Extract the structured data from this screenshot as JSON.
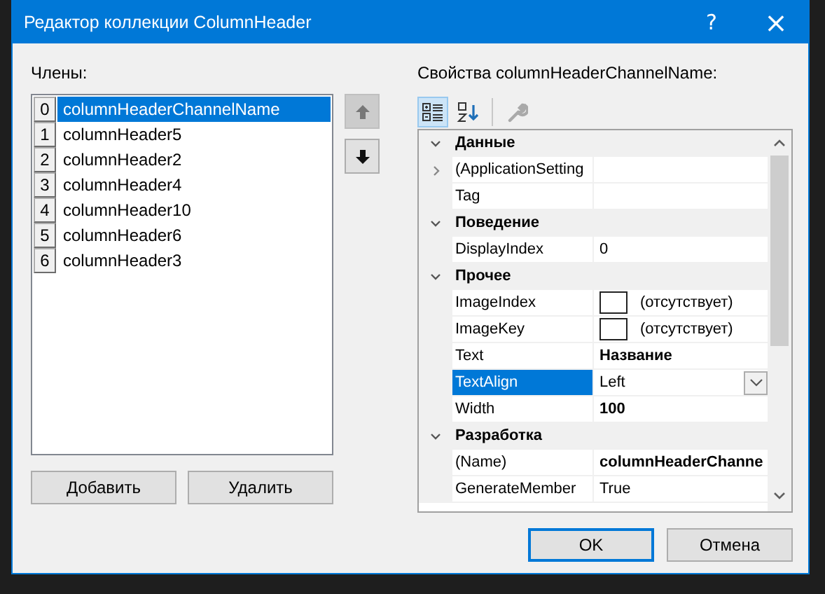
{
  "window": {
    "title": "Редактор коллекции ColumnHeader",
    "help": "?",
    "close": "×"
  },
  "members": {
    "label": "Члены:",
    "items": [
      {
        "index": "0",
        "name": "columnHeaderChannelName",
        "selected": true
      },
      {
        "index": "1",
        "name": "columnHeader5",
        "selected": false
      },
      {
        "index": "2",
        "name": "columnHeader2",
        "selected": false
      },
      {
        "index": "3",
        "name": "columnHeader4",
        "selected": false
      },
      {
        "index": "4",
        "name": "columnHeader10",
        "selected": false
      },
      {
        "index": "5",
        "name": "columnHeader6",
        "selected": false
      },
      {
        "index": "6",
        "name": "columnHeader3",
        "selected": false
      }
    ],
    "move_buttons": [
      {
        "kind": "up",
        "disabled": true
      },
      {
        "kind": "down",
        "disabled": false
      }
    ],
    "buttons": [
      "Добавить",
      "Удалить"
    ]
  },
  "properties": {
    "label": "Свойства columnHeaderChannelName:",
    "toolbar": [
      {
        "kind": "categorized",
        "selected": true,
        "disabled": false
      },
      {
        "kind": "alphabetical",
        "selected": false,
        "disabled": false
      },
      {
        "kind": "property-pages",
        "selected": false,
        "disabled": true
      }
    ],
    "categories": [
      {
        "name": "Данные",
        "expanded": true,
        "children": [
          {
            "name": "(ApplicationSetting",
            "kind": "text",
            "expandable": true,
            "selected": false
          },
          {
            "name": "Tag",
            "kind": "text",
            "expandable": false,
            "selected": false
          }
        ]
      },
      {
        "name": "Поведение",
        "expanded": true,
        "children": [
          {
            "name": "DisplayIndex",
            "value": "0",
            "kind": "text",
            "expandable": false,
            "modified": false,
            "selected": false
          }
        ]
      },
      {
        "name": "Прочее",
        "expanded": true,
        "children": [
          {
            "name": "ImageIndex",
            "value": "(отсутствует)",
            "kind": "image",
            "expandable": false,
            "modified": false,
            "selected": false
          },
          {
            "name": "ImageKey",
            "value": "(отсутствует)",
            "kind": "image",
            "expandable": false,
            "modified": false,
            "selected": false
          },
          {
            "name": "Text",
            "value": "Название",
            "kind": "text",
            "expandable": false,
            "modified": true,
            "selected": false
          },
          {
            "name": "TextAlign",
            "value": "Left",
            "kind": "dropdown",
            "expandable": false,
            "modified": false,
            "selected": true
          },
          {
            "name": "Width",
            "value": "100",
            "kind": "text",
            "expandable": false,
            "modified": true,
            "selected": false
          }
        ]
      },
      {
        "name": "Разработка",
        "expanded": true,
        "children": [
          {
            "name": "(Name)",
            "value": "columnHeaderChanne",
            "kind": "text",
            "expandable": false,
            "modified": true,
            "selected": false
          },
          {
            "name": "GenerateMember",
            "value": "True",
            "kind": "text",
            "expandable": false,
            "modified": false,
            "selected": false
          }
        ]
      }
    ]
  },
  "footer_buttons": [
    {
      "label": "OK",
      "default": true
    },
    {
      "label": "Отмена",
      "default": false
    }
  ]
}
